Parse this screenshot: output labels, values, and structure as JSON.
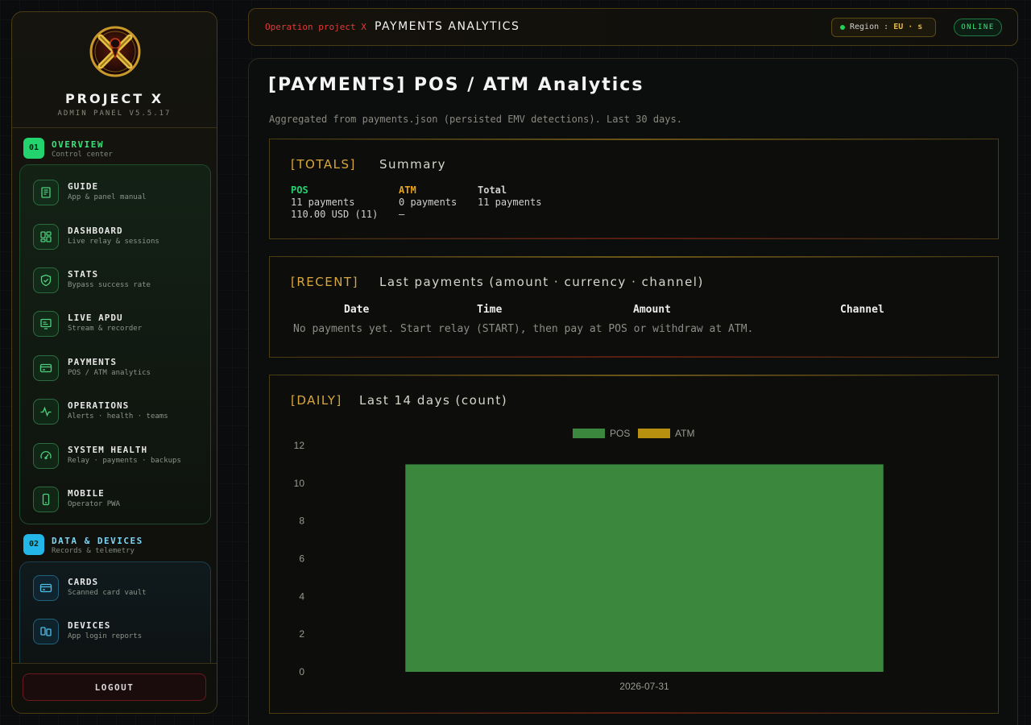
{
  "brand": {
    "title": "PROJECT X",
    "subtitle": "ADMIN PANEL V5.5.17"
  },
  "sections": [
    {
      "num": "01",
      "title": "OVERVIEW",
      "sub": "Control center",
      "color": "#22d36e"
    },
    {
      "num": "02",
      "title": "DATA & DEVICES",
      "sub": "Records & telemetry",
      "color": "#22b7e8"
    }
  ],
  "nav_overview": [
    {
      "label": "GUIDE",
      "sub": "App & panel manual",
      "icon": "book-icon"
    },
    {
      "label": "DASHBOARD",
      "sub": "Live relay & sessions",
      "icon": "dashboard-icon"
    },
    {
      "label": "STATS",
      "sub": "Bypass success rate",
      "icon": "shield-check-icon"
    },
    {
      "label": "LIVE APDU",
      "sub": "Stream & recorder",
      "icon": "monitor-icon"
    },
    {
      "label": "PAYMENTS",
      "sub": "POS / ATM analytics",
      "icon": "credit-card-icon"
    },
    {
      "label": "OPERATIONS",
      "sub": "Alerts · health · teams",
      "icon": "pulse-icon"
    },
    {
      "label": "SYSTEM HEALTH",
      "sub": "Relay · payments · backups",
      "icon": "gauge-icon"
    },
    {
      "label": "MOBILE",
      "sub": "Operator PWA",
      "icon": "phone-icon"
    }
  ],
  "nav_data": [
    {
      "label": "CARDS",
      "sub": "Scanned card vault",
      "icon": "card-icon"
    },
    {
      "label": "DEVICES",
      "sub": "App login reports",
      "icon": "devices-icon"
    }
  ],
  "logout_label": "LOGOUT",
  "topbar": {
    "operation": "Operation project X",
    "page": "PAYMENTS ANALYTICS",
    "region_label": "Region :",
    "region_value": "EU · s",
    "status": "ONLINE"
  },
  "page": {
    "title": "[PAYMENTS] POS / ATM Analytics",
    "description": "Aggregated from payments.json (persisted EMV detections). Last 30 days."
  },
  "totals": {
    "tag": "[TOTALS]",
    "heading": "Summary",
    "pos": {
      "label": "POS",
      "count": "11 payments",
      "amount": "110.00 USD (11)"
    },
    "atm": {
      "label": "ATM",
      "count": "0 payments",
      "amount": "–"
    },
    "total": {
      "label": "Total",
      "count": "11 payments"
    }
  },
  "recent": {
    "tag": "[RECENT]",
    "heading": "Last payments (amount · currency · channel)",
    "columns": [
      "Date",
      "Time",
      "Amount",
      "Channel"
    ],
    "empty": "No payments yet. Start relay (START), then pay at POS or withdraw at ATM."
  },
  "daily": {
    "tag": "[DAILY]",
    "heading": "Last 14 days (count)"
  },
  "colors": {
    "pos": "#3a873d",
    "atm": "#b8900f",
    "accent": "#d9a73a",
    "danger": "#e23a3a"
  },
  "chart_data": {
    "type": "bar",
    "categories": [
      "2026-07-31"
    ],
    "series": [
      {
        "name": "POS",
        "values": [
          11
        ]
      },
      {
        "name": "ATM",
        "values": [
          0
        ]
      }
    ],
    "ylim": [
      0,
      12
    ],
    "yticks": [
      0,
      2,
      4,
      6,
      8,
      10,
      12
    ],
    "legend": "top-center",
    "grid": false
  }
}
